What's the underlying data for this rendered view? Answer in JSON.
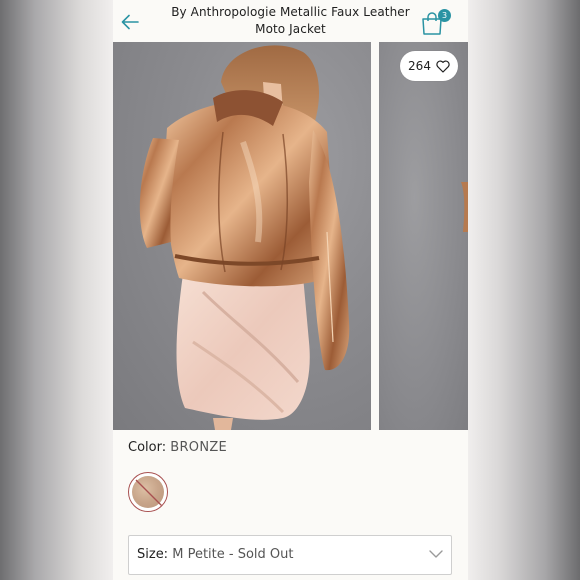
{
  "header": {
    "title_line1": "By Anthropologie Metallic Faux Leather",
    "title_line2": "Moto Jacket",
    "back_icon": "arrow-left-icon",
    "cart_icon": "shopping-bag-icon",
    "cart_count": "3"
  },
  "gallery": {
    "like_count": "264",
    "like_icon": "heart-icon"
  },
  "color": {
    "label": "Color:",
    "value": "BRONZE",
    "swatch_state": "unavailable",
    "swatch_color": "#c8a58a"
  },
  "size": {
    "label": "Size:",
    "value": "M Petite - Sold Out",
    "chevron_icon": "chevron-down-icon"
  },
  "colors": {
    "accent": "#2a93a3",
    "unavailable": "#a85050"
  }
}
